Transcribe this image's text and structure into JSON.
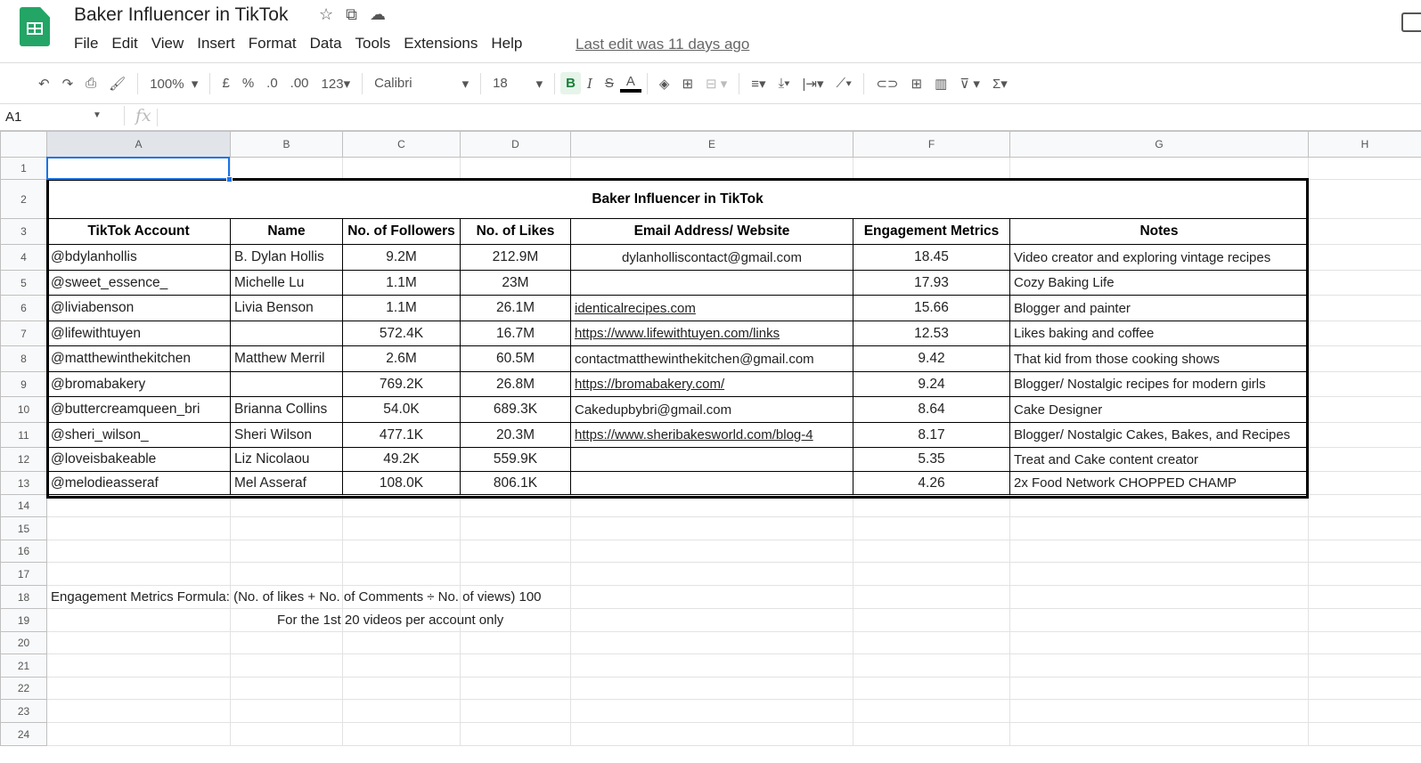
{
  "app": {
    "title": "Baker Influencer in TikTok",
    "last_edit": "Last edit was 11 days ago",
    "menu": [
      "File",
      "Edit",
      "View",
      "Insert",
      "Format",
      "Data",
      "Tools",
      "Extensions",
      "Help"
    ]
  },
  "toolbar": {
    "zoom": "100%",
    "currency": "£",
    "percent": "%",
    "dec_less": ".0",
    "dec_more": ".00",
    "format_more": "123",
    "font": "Calibri",
    "font_size": "18",
    "bold": "B",
    "italic": "I",
    "strike": "S",
    "text_color": "A"
  },
  "formula_bar": {
    "cell_ref": "A1",
    "fx": "fx",
    "value": ""
  },
  "columns": [
    "A",
    "B",
    "C",
    "D",
    "E",
    "F",
    "G",
    "H"
  ],
  "sheet": {
    "title": "Baker Influencer in TikTok",
    "headers": [
      "TikTok Account",
      "Name",
      "No. of Followers",
      "No. of Likes",
      "Email Address/ Website",
      "Engagement Metrics",
      "Notes"
    ],
    "rows": [
      [
        "@bdylanhollis",
        "B. Dylan Hollis",
        "9.2M",
        "212.9M",
        "dylanholliscontact@gmail.com",
        "18.45",
        "Video creator and exploring vintage recipes"
      ],
      [
        "@sweet_essence_",
        "Michelle Lu",
        "1.1M",
        "23M",
        "",
        "17.93",
        "Cozy Baking Life"
      ],
      [
        "@liviabenson",
        "Livia Benson",
        "1.1M",
        "26.1M",
        "identicalrecipes.com",
        "15.66",
        "Blogger and painter"
      ],
      [
        "@lifewithtuyen",
        "",
        "572.4K",
        "16.7M",
        "https://www.lifewithtuyen.com/links",
        "12.53",
        "Likes baking and coffee"
      ],
      [
        "@matthewinthekitchen",
        "Matthew Merril",
        "2.6M",
        "60.5M",
        "contactmatthewinthekitchen@gmail.com",
        "9.42",
        "That kid from those cooking shows"
      ],
      [
        "@bromabakery",
        "",
        "769.2K",
        "26.8M",
        "https://bromabakery.com/",
        "9.24",
        "Blogger/ Nostalgic recipes for modern girls"
      ],
      [
        "@buttercreamqueen_bri",
        "Brianna Collins",
        "54.0K",
        "689.3K",
        "Cakedupbybri@gmail.com",
        "8.64",
        "Cake Designer"
      ],
      [
        "@sheri_wilson_",
        "Sheri Wilson",
        "477.1K",
        "20.3M",
        "https://www.sheribakesworld.com/blog-4",
        "8.17",
        "Blogger/ Nostalgic Cakes, Bakes, and Recipes"
      ],
      [
        "@loveisbakeable",
        "Liz Nicolaou",
        "49.2K",
        "559.9K",
        "",
        "5.35",
        "Treat and Cake content creator"
      ],
      [
        "@melodieasseraf",
        "Mel Asseraf",
        "108.0K",
        "806.1K",
        "",
        "4.26",
        "2x Food Network CHOPPED CHAMP"
      ]
    ],
    "formula_note": "Engagement Metrics Formula: (No. of likes + No. of Comments ÷ No. of views) 100",
    "formula_note2": "For the 1st 20 videos per account only"
  }
}
